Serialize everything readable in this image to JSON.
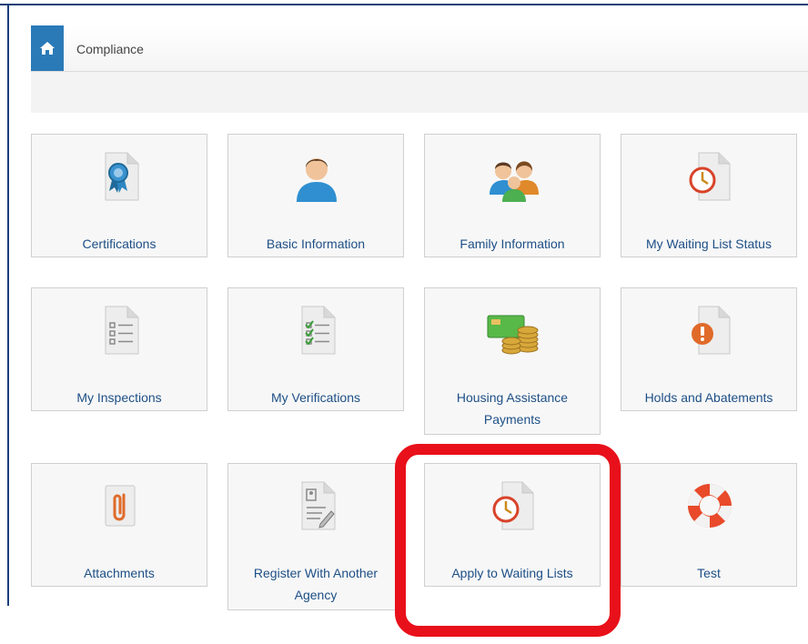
{
  "breadcrumb": {
    "label": "Compliance"
  },
  "tiles": [
    {
      "label": "Certifications",
      "icon": "certificate-ribbon-icon"
    },
    {
      "label": "Basic Information",
      "icon": "person-icon"
    },
    {
      "label": "Family Information",
      "icon": "family-icon"
    },
    {
      "label": "My Waiting List Status",
      "icon": "clock-document-icon"
    },
    {
      "label": "My Inspections",
      "icon": "checklist-document-icon"
    },
    {
      "label": "My Verifications",
      "icon": "checked-list-document-icon"
    },
    {
      "label": "Housing Assistance Payments",
      "icon": "money-coins-icon"
    },
    {
      "label": "Holds and Abatements",
      "icon": "alert-document-icon"
    },
    {
      "label": "Attachments",
      "icon": "paperclip-icon"
    },
    {
      "label": "Register With Another Agency",
      "icon": "register-form-icon"
    },
    {
      "label": "Apply to Waiting Lists",
      "icon": "clock-document-icon"
    },
    {
      "label": "Test",
      "icon": "life-ring-icon"
    }
  ],
  "colors": {
    "accent": "#2a7ab8",
    "highlight": "#e8101a",
    "link": "#1d4f86"
  }
}
